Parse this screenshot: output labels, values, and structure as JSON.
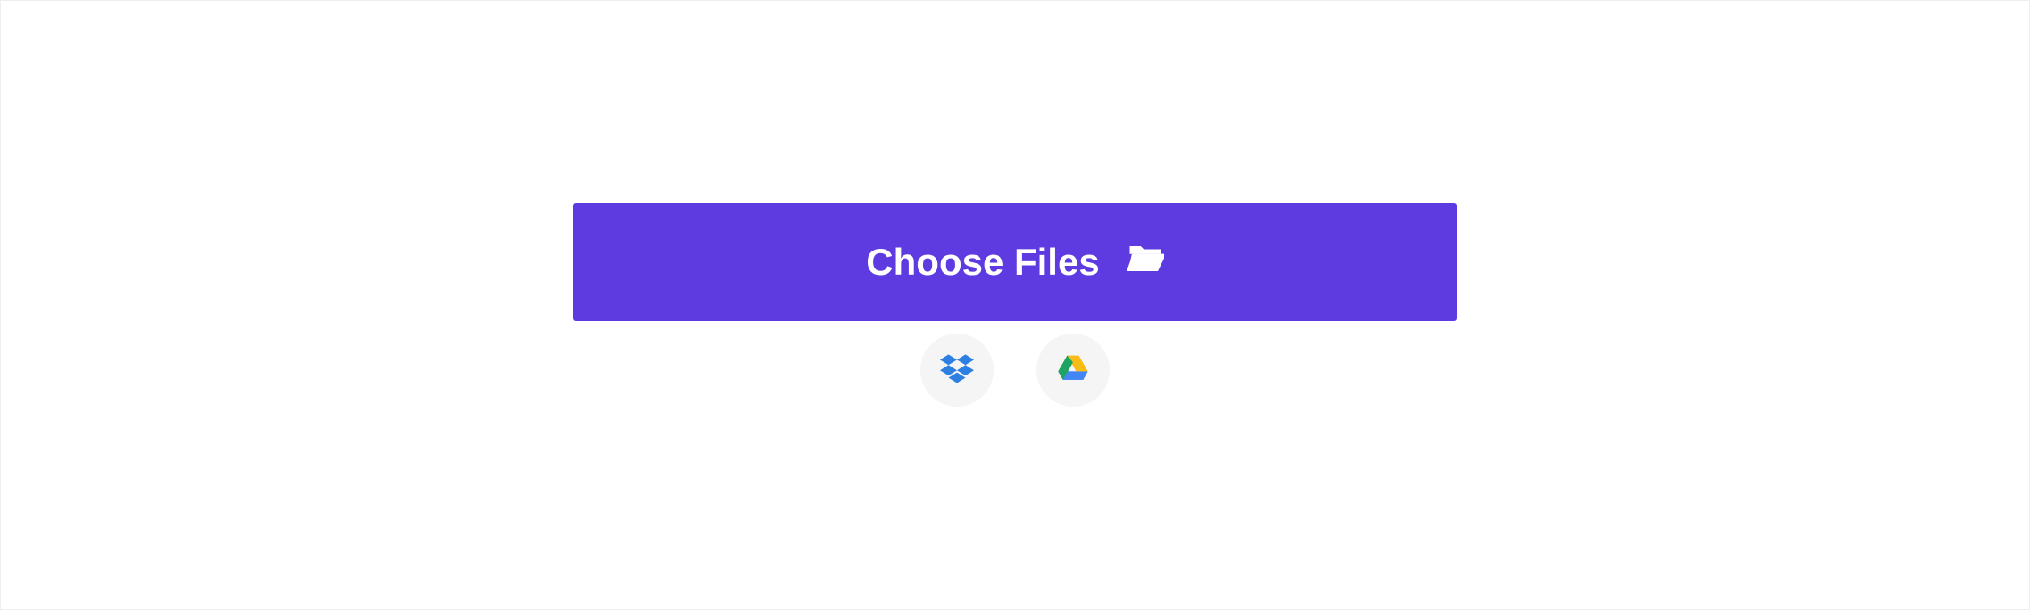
{
  "upload": {
    "choose_files_label": "Choose Files",
    "cloud_sources": {
      "dropbox_name": "dropbox",
      "gdrive_name": "google-drive"
    }
  },
  "colors": {
    "primary": "#5e3be1",
    "button_bg": "#f5f5f5"
  }
}
